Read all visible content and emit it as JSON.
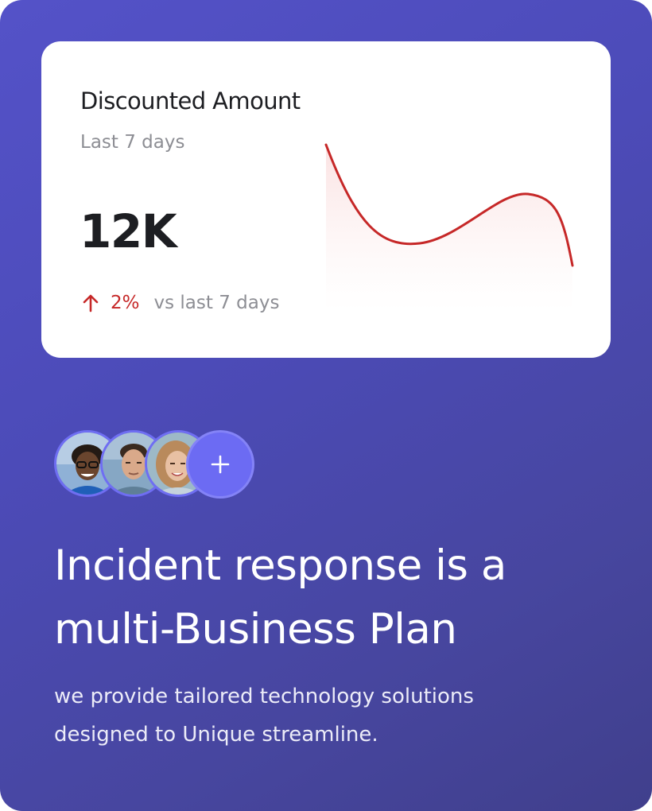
{
  "card": {
    "title": "Discounted Amount",
    "subtitle": "Last 7 days",
    "value": "12K",
    "trend": {
      "direction": "up",
      "percent": "2%",
      "label": "vs last 7 days",
      "color": "#c62828"
    }
  },
  "avatars": {
    "count_shown": 3,
    "add_symbol": "+"
  },
  "headline": {
    "line1": "Incident response is a",
    "line2": "multi-Business Plan"
  },
  "description": {
    "line1": "we provide tailored technology solutions",
    "line2": "designed to Unique streamline."
  },
  "colors": {
    "background": "#4c4bb8",
    "accent": "#6c6bf3",
    "curve": "#c62828"
  },
  "icons": {
    "trend": "arrow-up-icon",
    "add": "plus-icon"
  }
}
